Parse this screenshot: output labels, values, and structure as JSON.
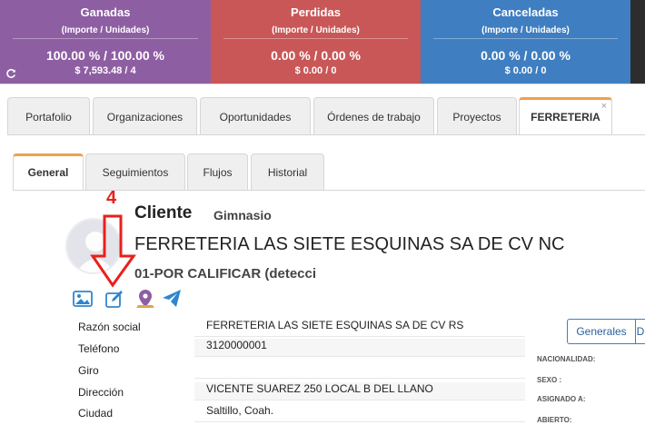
{
  "stats": [
    {
      "title": "Ganadas",
      "subtitle": "(Importe / Unidades)",
      "percent": "100.00 % / 100.00 %",
      "amount": "$ 7,593.48 / 4",
      "color": "#8e5ea2"
    },
    {
      "title": "Perdidas",
      "subtitle": "(Importe / Unidades)",
      "percent": "0.00 % / 0.00 %",
      "amount": "$ 0.00 / 0",
      "color": "#c95757"
    },
    {
      "title": "Canceladas",
      "subtitle": "(Importe / Unidades)",
      "percent": "0.00 % / 0.00 %",
      "amount": "$ 0.00 / 0",
      "color": "#3f7ec1"
    }
  ],
  "top_tabs": [
    "Portafolio",
    "Organizaciones",
    "Oportunidades",
    "Órdenes de trabajo",
    "Proyectos",
    "FERRETERIA"
  ],
  "top_tab_close": "×",
  "inner_tabs": [
    "General",
    "Seguimientos",
    "Flujos",
    "Historial"
  ],
  "annotation": {
    "number": "4"
  },
  "client": {
    "label": "Cliente",
    "type": "Gimnasio",
    "name": "FERRETERIA LAS SIETE ESQUINAS SA DE CV NC",
    "status": "01-POR CALIFICAR (detecci"
  },
  "action_icons": [
    "image-icon",
    "edit-icon",
    "map-pin-icon",
    "send-icon"
  ],
  "details": [
    {
      "label": "Razón social",
      "value": "FERRETERIA LAS SIETE ESQUINAS SA DE CV RS"
    },
    {
      "label": "Teléfono",
      "value": "3120000001"
    },
    {
      "label": "Giro",
      "value": ""
    },
    {
      "label": "Dirección",
      "value": "VICENTE SUAREZ 250 LOCAL B DEL LLANO"
    },
    {
      "label": "Ciudad",
      "value": "Saltillo, Coah."
    }
  ],
  "right_panel": {
    "button_generales": "Generales",
    "button_second": "D",
    "labels": [
      "NACIONALIDAD:",
      "SEXO :",
      "ASIGNADO A:",
      "ABIERTO:"
    ]
  },
  "colors": {
    "accent_tab": "#f0a04b",
    "ganadas": "#8e5ea2",
    "perdidas": "#c95757",
    "canceladas": "#3f7ec1",
    "annotation": "#e8201b",
    "icon_blue": "#2f86cf",
    "icon_purple": "#8e5ea2"
  }
}
